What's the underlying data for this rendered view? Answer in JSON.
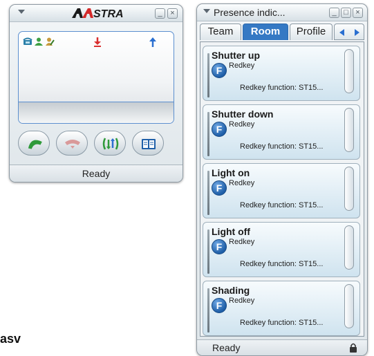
{
  "phone_window": {
    "brand": "AASTRA",
    "status": "Ready",
    "buttons": [
      {
        "icon": "answer-call-icon"
      },
      {
        "icon": "hang-up-icon"
      },
      {
        "icon": "transfer-icon"
      },
      {
        "icon": "phonebook-icon"
      }
    ],
    "indicators": [
      {
        "icon": "phone-status-icon"
      },
      {
        "icon": "user-presence-icon"
      },
      {
        "icon": "user-edit-icon"
      },
      {
        "icon": "incoming-call-arrow-icon",
        "color": "#d93030"
      },
      {
        "icon": "outgoing-call-arrow-icon",
        "color": "#2a6fd0"
      }
    ],
    "accent": "#5b8fcf"
  },
  "presence_window": {
    "title": "Presence indic...",
    "tabs": [
      {
        "label": "Team",
        "active": false
      },
      {
        "label": "Room",
        "active": true
      },
      {
        "label": "Profile",
        "active": false
      }
    ],
    "active_tab_color": "#3579c4",
    "cards": [
      {
        "name": "Shutter up",
        "badge": "F",
        "type": "Redkey",
        "function": "Redkey function: ST15..."
      },
      {
        "name": "Shutter down",
        "badge": "F",
        "type": "Redkey",
        "function": "Redkey function: ST15..."
      },
      {
        "name": "Light on",
        "badge": "F",
        "type": "Redkey",
        "function": "Redkey function: ST15..."
      },
      {
        "name": "Light off",
        "badge": "F",
        "type": "Redkey",
        "function": "Redkey function: ST15..."
      },
      {
        "name": "Shading",
        "badge": "F",
        "type": "Redkey",
        "function": "Redkey function: ST15..."
      }
    ],
    "status": "Ready"
  },
  "corner_label": "asv"
}
